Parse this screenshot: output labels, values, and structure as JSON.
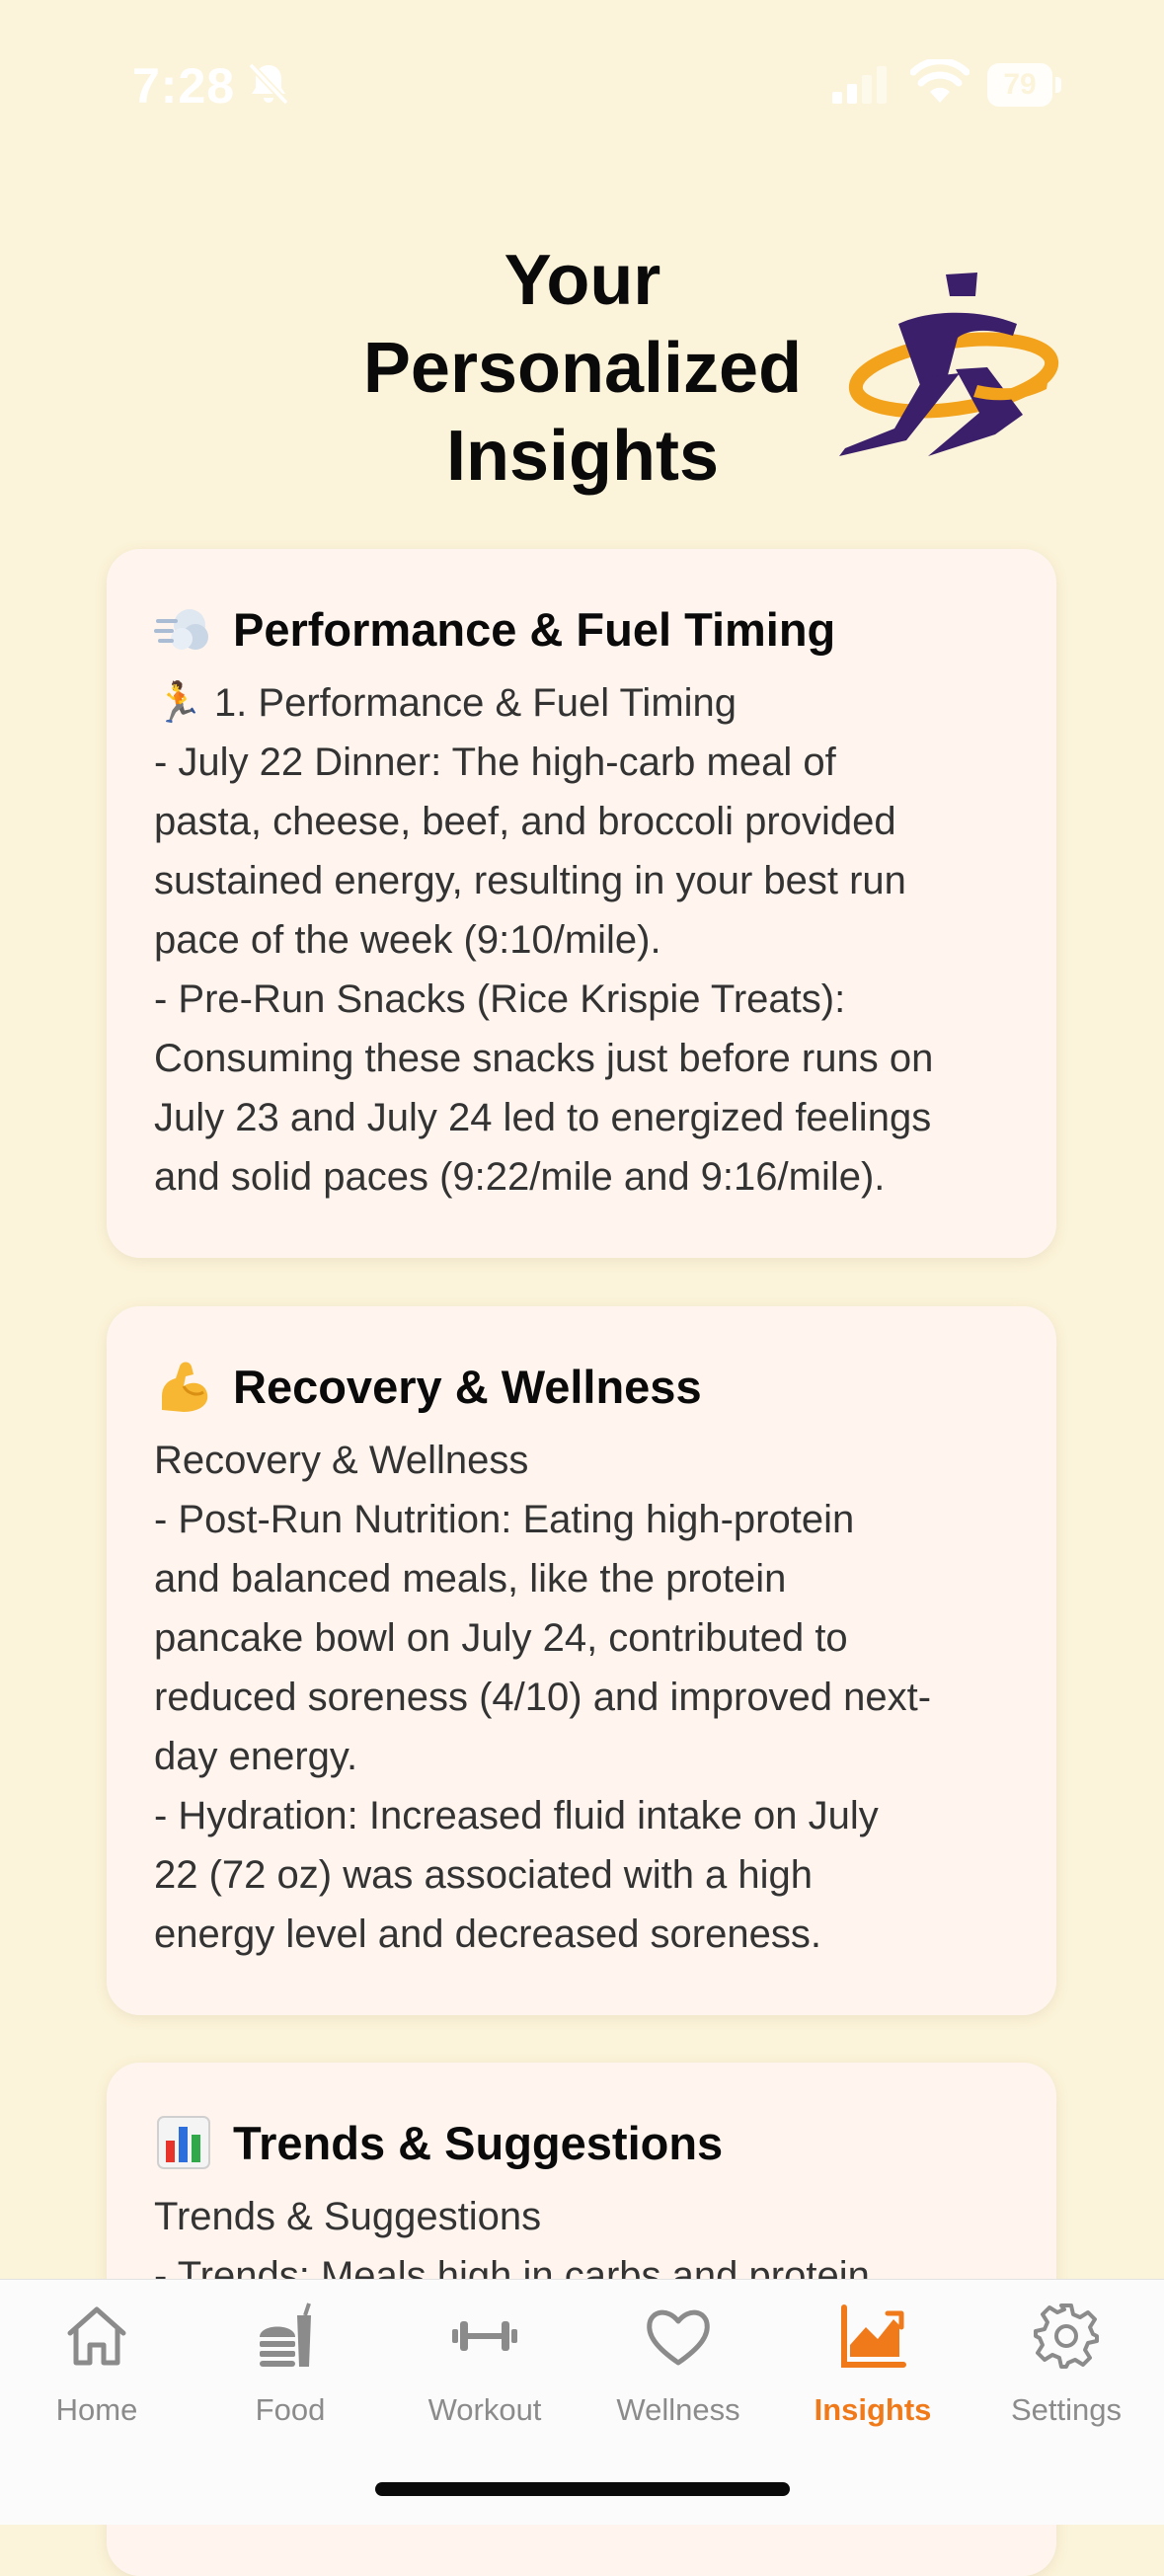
{
  "status_bar": {
    "time": "7:28",
    "battery": "79"
  },
  "header": {
    "title_lines": [
      "Your",
      "Personalized",
      "Insights"
    ]
  },
  "cards": [
    {
      "emoji": "dash-icon",
      "title": "Performance & Fuel Timing",
      "lines": [
        "🏃 1. Performance & Fuel Timing",
        "- July 22 Dinner: The high-carb meal of",
        "pasta, cheese, beef, and broccoli provided",
        "sustained energy, resulting in your best run",
        "pace of the week (9:10/mile).",
        "- Pre-Run Snacks (Rice Krispie Treats):",
        "Consuming these snacks just before runs on",
        "July 23 and July 24 led to energized feelings",
        "and solid paces (9:22/mile and 9:16/mile)."
      ]
    },
    {
      "emoji": "flexed-biceps-icon",
      "title": "Recovery & Wellness",
      "lines": [
        "Recovery & Wellness",
        "- Post-Run Nutrition: Eating high-protein",
        "and balanced meals, like the protein",
        "pancake bowl on July 24, contributed to",
        "reduced soreness (4/10) and improved next-",
        "day energy.",
        "- Hydration: Increased fluid intake on July",
        "22 (72 oz) was associated with a high",
        "energy level and decreased soreness."
      ]
    },
    {
      "emoji": "bar-chart-icon",
      "title": "Trends & Suggestions",
      "lines": [
        "Trends & Suggestions",
        "- Trends: Meals high in carbs and protein"
      ]
    }
  ],
  "tabs": [
    {
      "label": "Home",
      "icon": "home-icon",
      "active": false
    },
    {
      "label": "Food",
      "icon": "burger-drink-icon",
      "active": false
    },
    {
      "label": "Workout",
      "icon": "dumbbell-icon",
      "active": false
    },
    {
      "label": "Wellness",
      "icon": "heart-icon",
      "active": false
    },
    {
      "label": "Insights",
      "icon": "trend-chart-icon",
      "active": true
    },
    {
      "label": "Settings",
      "icon": "gear-icon",
      "active": false
    }
  ],
  "colors": {
    "background": "#fcf4da",
    "card": "#fff5ee",
    "accent": "#f07a1a",
    "logo_purple": "#3b1f6b",
    "logo_orange": "#f3a21c"
  }
}
